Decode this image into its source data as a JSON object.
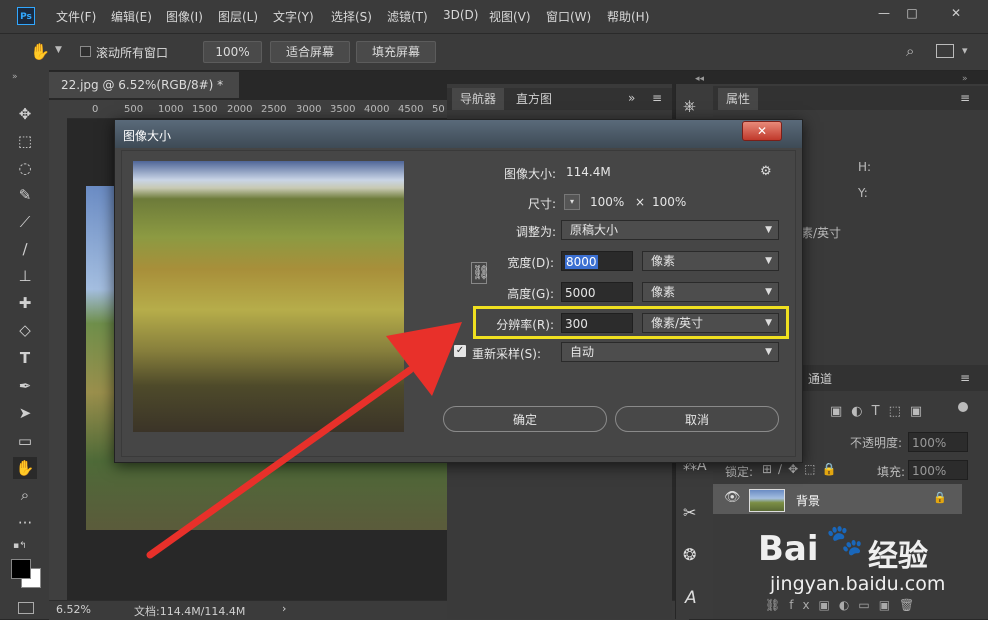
{
  "app": {
    "logo": "Ps"
  },
  "menu": [
    "文件(F)",
    "编辑(E)",
    "图像(I)",
    "图层(L)",
    "文字(Y)",
    "选择(S)",
    "滤镜(T)",
    "3D(D)",
    "视图(V)",
    "窗口(W)",
    "帮助(H)"
  ],
  "window_controls": [
    "—",
    "□",
    "✕"
  ],
  "options_bar": {
    "scroll_all_label": "滚动所有窗口",
    "zoom_100": "100%",
    "fit_screen": "适合屏幕",
    "fill_screen": "填充屏幕"
  },
  "document": {
    "tab_title": "22.jpg @ 6.52%(RGB/8#) *",
    "tab_close": "×",
    "ruler_ticks": [
      "0",
      "500",
      "1000",
      "1500",
      "2000",
      "2500",
      "3000",
      "3500",
      "4000",
      "4500",
      "50"
    ]
  },
  "status": {
    "zoom": "6.52%",
    "doc_info": "文档:114.4M/114.4M"
  },
  "panels": {
    "navigator_tab": "导航器",
    "histogram_tab": "直方图",
    "properties_tab": "属性",
    "channels_tab": "通道",
    "h_label": "H:",
    "y_label": "Y:",
    "unit_partial": "素/英寸",
    "opacity_label": "不透明度:",
    "opacity_value": "100%",
    "lock_label": "锁定:",
    "fill_label": "填充:",
    "fill_value": "100%",
    "layer_name": "背景"
  },
  "dialog": {
    "title": "图像大小",
    "close": "✕",
    "image_size_label": "图像大小:",
    "image_size_value": "114.4M",
    "dimensions_label": "尺寸:",
    "dim_w": "100%",
    "dim_x": "×",
    "dim_h": "100%",
    "fit_to_label": "调整为:",
    "fit_to_value": "原稿大小",
    "width_label": "宽度(D):",
    "width_value": "8000",
    "width_unit": "像素",
    "height_label": "高度(G):",
    "height_value": "5000",
    "height_unit": "像素",
    "resolution_label": "分辨率(R):",
    "resolution_value": "300",
    "resolution_unit": "像素/英寸",
    "resample_label": "重新采样(S):",
    "resample_value": "自动",
    "ok": "确定",
    "cancel": "取消"
  },
  "watermark": {
    "brand": "Bai",
    "brand2": "经验",
    "url": "jingyan.baidu.com"
  },
  "colors": {
    "highlight": "#f0e020",
    "arrow": "#e8302a",
    "accent": "#31a8ff"
  }
}
